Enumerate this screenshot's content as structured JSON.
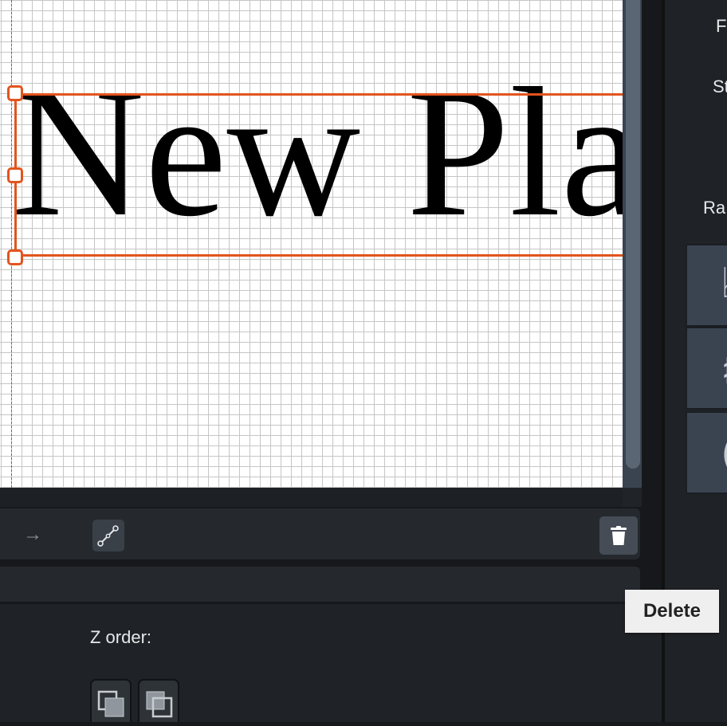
{
  "canvas": {
    "frame_text": "New Pla"
  },
  "toolbar": {
    "arrow_icon": "right-arrow-icon",
    "line_tool_icon": "line-tool-icon",
    "delete_icon": "trash-icon"
  },
  "properties": {
    "z_order_label": "Z order:",
    "z_back_icon": "send-backward-icon",
    "z_front_icon": "bring-forward-icon"
  },
  "right_panel": {
    "label_font_partial": "Fo",
    "label_style_partial": "St",
    "label_range_partial": "Ra",
    "accidentals": [
      "flat",
      "sharp",
      "natural"
    ]
  },
  "tooltip": {
    "delete": "Delete"
  },
  "colors": {
    "selection": "#e2541e",
    "panel_dark": "#1f2226",
    "scroll": "#3a4451"
  }
}
